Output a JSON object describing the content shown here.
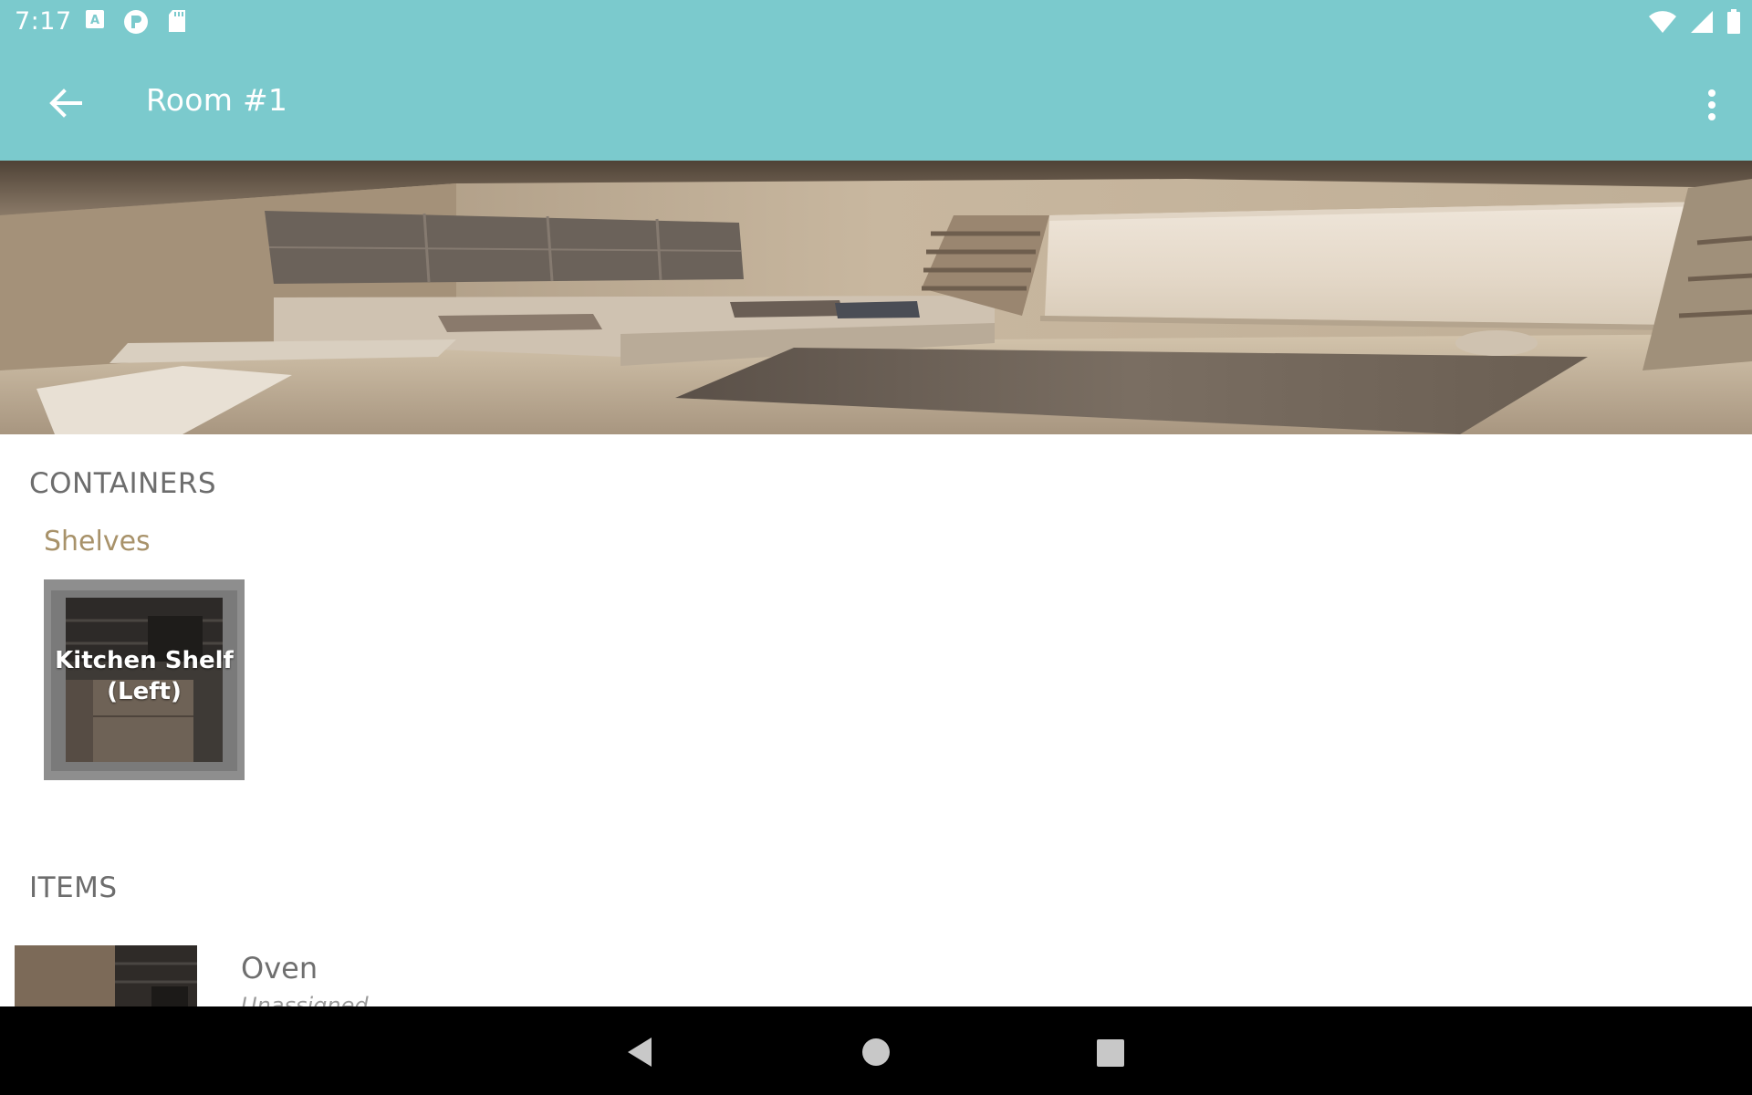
{
  "status_bar": {
    "time": "7:17",
    "left_icons": [
      "keyboard-a-icon",
      "p-circle-icon",
      "sd-card-icon"
    ],
    "right_icons": [
      "wifi-icon",
      "cell-signal-icon",
      "battery-icon"
    ]
  },
  "app_bar": {
    "title": "Room #1",
    "back_icon": "arrow-left-icon",
    "menu_icon": "more-vert-icon"
  },
  "hero_image": {
    "description_icon": "room-photo"
  },
  "containers": {
    "section_title": "CONTAINERS",
    "groups": [
      {
        "name": "Shelves",
        "items": [
          {
            "label_line1": "Kitchen Shelf",
            "label_line2": "(Left)"
          }
        ]
      }
    ]
  },
  "items": {
    "section_title": "ITEMS",
    "list": [
      {
        "name": "Oven",
        "location": "Unassigned"
      }
    ]
  },
  "nav_bar": {
    "icons": [
      "back-triangle-icon",
      "home-circle-icon",
      "recents-square-icon"
    ]
  },
  "colors": {
    "accent": "#7bcacd",
    "category": "#a8926a",
    "section": "#6d6d6d"
  }
}
